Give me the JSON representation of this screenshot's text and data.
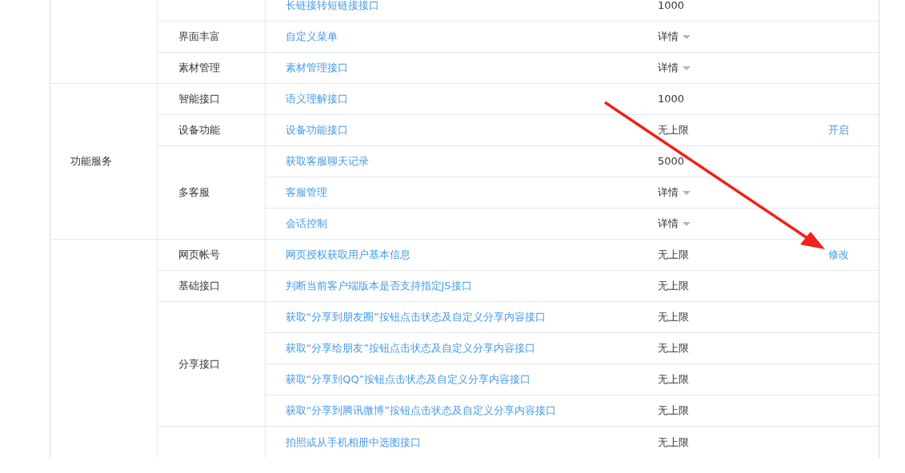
{
  "groups": [
    {
      "subgroups": [
        {
          "apis": [
            {
              "name": "长链接转短链接接口",
              "quota": "1000",
              "dropdown": false
            }
          ]
        },
        {
          "name": "界面丰富",
          "apis": [
            {
              "name": "自定义菜单",
              "quota": "详情",
              "dropdown": true
            }
          ]
        },
        {
          "name": "素材管理",
          "apis": [
            {
              "name": "素材管理接口",
              "quota": "详情",
              "dropdown": true
            }
          ]
        }
      ]
    },
    {
      "category": "功能服务",
      "subgroups": [
        {
          "name": "智能接口",
          "apis": [
            {
              "name": "语义理解接口",
              "quota": "1000",
              "dropdown": false
            }
          ]
        },
        {
          "name": "设备功能",
          "apis": [
            {
              "name": "设备功能接口",
              "quota": "无上限",
              "dropdown": false,
              "action": "开启"
            }
          ]
        },
        {
          "name": "多客服",
          "apis": [
            {
              "name": "获取客服聊天记录",
              "quota": "5000",
              "dropdown": false
            },
            {
              "name": "客服管理",
              "quota": "详情",
              "dropdown": true
            },
            {
              "name": "会话控制",
              "quota": "详情",
              "dropdown": true
            }
          ]
        }
      ]
    },
    {
      "subgroups": [
        {
          "name": "网页帐号",
          "apis": [
            {
              "name": "网页授权获取用户基本信息",
              "quota": "无上限",
              "dropdown": false,
              "action": "修改"
            }
          ]
        },
        {
          "name": "基础接口",
          "apis": [
            {
              "name": "判断当前客户端版本是否支持指定JS接口",
              "quota": "无上限",
              "dropdown": false
            }
          ]
        },
        {
          "name": "分享接口",
          "apis": [
            {
              "name": "获取“分享到朋友圈”按钮点击状态及自定义分享内容接口",
              "quota": "无上限",
              "dropdown": false
            },
            {
              "name": "获取“分享给朋友”按钮点击状态及自定义分享内容接口",
              "quota": "无上限",
              "dropdown": false
            },
            {
              "name": "获取“分享到QQ”按钮点击状态及自定义分享内容接口",
              "quota": "无上限",
              "dropdown": false
            },
            {
              "name": "获取“分享到腾讯微博”按钮点击状态及自定义分享内容接口",
              "quota": "无上限",
              "dropdown": false
            }
          ]
        },
        {
          "apis": [
            {
              "name": "拍照或从手机相册中选图接口",
              "quota": "无上限",
              "dropdown": false
            }
          ]
        }
      ]
    }
  ]
}
